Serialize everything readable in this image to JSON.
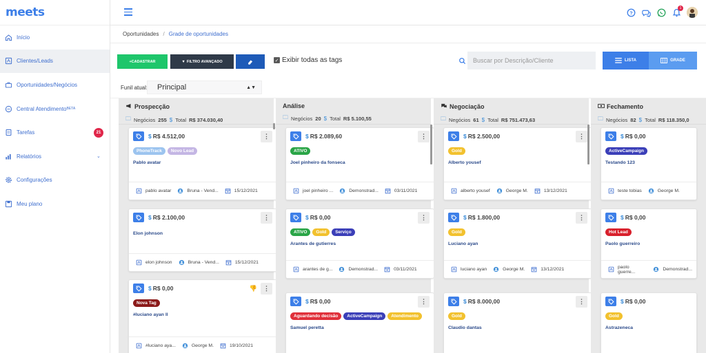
{
  "app": {
    "logo": "meets"
  },
  "sidebar": {
    "items": [
      {
        "label": "Início",
        "icon": "home-icon"
      },
      {
        "label": "Clientes/Leads",
        "icon": "contact-card-icon",
        "active": true
      },
      {
        "label": "Oportunidades/Negócios",
        "icon": "briefcase-icon"
      },
      {
        "label": "Central Atendimento",
        "sup": "BETA",
        "icon": "chat-icon"
      },
      {
        "label": "Tarefas",
        "icon": "tasks-icon",
        "badge": "21"
      },
      {
        "label": "Relatórios",
        "icon": "bar-chart-icon",
        "chevron": "⌄"
      },
      {
        "label": "Configurações",
        "icon": "gear-icon"
      },
      {
        "label": "Meu plano",
        "icon": "plan-icon"
      }
    ]
  },
  "topbar": {
    "notification_count": "1"
  },
  "breadcrumb": {
    "root": "Oportunidades",
    "separator": "/",
    "current": "Grade de oportunidades"
  },
  "toolbar": {
    "cadastrar": "+CADASTRAR",
    "filtro": "FILTRO AVANÇADO",
    "show_all_tags": "Exibir todas as tags",
    "search_placeholder": "Buscar por Descrição/Cliente",
    "lista": "LISTA",
    "grade": "GRADE"
  },
  "funnel": {
    "label": "Funil atual:",
    "value": "Principal"
  },
  "colors": {
    "accent": "#3d7fe8",
    "green": "#1ec66b",
    "dark": "#2f3a48",
    "navy": "#1e5bb8",
    "red_badge": "#e0274a"
  },
  "columns": [
    {
      "title": "Prospecção",
      "icon": "megaphone-icon",
      "negocios_label": "Negócios",
      "negocios": "255",
      "total_label": "Total",
      "total": "R$ 374.030,40",
      "cards": [
        {
          "value": "R$ 4.512,00",
          "tags": [
            {
              "text": "PhoneTrack",
              "color": "#9cc4ef"
            },
            {
              "text": "Novo Lead",
              "color": "#c4b6e4"
            }
          ],
          "name": "Pablo avatar",
          "client": "pablo avatar",
          "owner": "Bruna - Vend...",
          "date": "15/12/2021"
        },
        {
          "value": "R$ 2.100,00",
          "tags": [],
          "name": "Elon johnson",
          "client": "elon johnson",
          "owner": "Bruna - Vend...",
          "date": "15/12/2021"
        },
        {
          "value": "R$ 0,00",
          "tags": [
            {
              "text": "Nova Tag",
              "color": "#8b1a1a"
            }
          ],
          "name": "#luciano ayan ll",
          "client": "#luciano aya...",
          "owner": "George M.",
          "date": "19/10/2021",
          "thumb": "👎"
        }
      ]
    },
    {
      "title": "Análise",
      "icon": "",
      "negocios_label": "Negócios",
      "negocios": "20",
      "total_label": "Total",
      "total": "R$ 5.100,55",
      "cards": [
        {
          "value": "R$ 2.089,60",
          "tags": [
            {
              "text": "ATIVO",
              "color": "#2aa547"
            }
          ],
          "name": "Joel pinheiro da fonseca",
          "client": "joel pinheiro ...",
          "owner": "Demonstrad...",
          "date": "03/11/2021"
        },
        {
          "value": "R$ 0,00",
          "tags": [
            {
              "text": "ATIVO",
              "color": "#2aa547"
            },
            {
              "text": "Gold",
              "color": "#f2c12e"
            },
            {
              "text": "Serviço",
              "color": "#3b3fb8"
            }
          ],
          "name": "Arantes de gutierres",
          "client": "arantes de g...",
          "owner": "Demonstrad...",
          "date": "03/11/2021"
        },
        {
          "value": "R$ 0,00",
          "tags": [
            {
              "text": "Aguardando decisão",
              "color": "#e0303a"
            },
            {
              "text": "ActiveCampaign",
              "color": "#3b3fb8"
            },
            {
              "text": "Atendimento",
              "color": "#f2c12e"
            }
          ],
          "name": "Samuel peretta",
          "client": "",
          "owner": "",
          "date": ""
        }
      ]
    },
    {
      "title": "Negociação",
      "icon": "comments-icon",
      "negocios_label": "Negócios",
      "negocios": "61",
      "total_label": "Total",
      "total": "R$ 751.473,63",
      "cards": [
        {
          "value": "R$ 2.500,00",
          "tags": [
            {
              "text": "Gold",
              "color": "#f2c12e"
            }
          ],
          "name": "Alberto yousef",
          "client": "alberto yousef",
          "owner": "George M.",
          "date": "13/12/2021"
        },
        {
          "value": "R$ 1.800,00",
          "tags": [
            {
              "text": "Gold",
              "color": "#f2c12e"
            }
          ],
          "name": "Luciano ayan",
          "client": "luciano ayan",
          "owner": "George M.",
          "date": "13/12/2021"
        },
        {
          "value": "R$ 8.000,00",
          "tags": [
            {
              "text": "Gold",
              "color": "#f2c12e"
            }
          ],
          "name": "Claudio dantas",
          "client": "",
          "owner": "",
          "date": ""
        }
      ]
    },
    {
      "title": "Fechamento",
      "icon": "money-icon",
      "negocios_label": "Negócios",
      "negocios": "82",
      "total_label": "Total",
      "total": "R$ 118.350,0",
      "cards": [
        {
          "value": "R$ 0,00",
          "tags": [
            {
              "text": "ActiveCampaign",
              "color": "#3b3fb8"
            }
          ],
          "name": "Testando 123",
          "client": "teste tobias",
          "owner": "George M.",
          "date": ""
        },
        {
          "value": "R$ 0,00",
          "tags": [
            {
              "text": "Hot Lead",
              "color": "#d8202c"
            }
          ],
          "name": "Paolo guerreiro",
          "client": "paolo guerre...",
          "owner": "Demonstrad...",
          "date": ""
        },
        {
          "value": "R$ 0,00",
          "tags": [
            {
              "text": "Gold",
              "color": "#f2c12e"
            }
          ],
          "name": "Astrazeneca",
          "client": "",
          "owner": "",
          "date": ""
        }
      ]
    }
  ]
}
